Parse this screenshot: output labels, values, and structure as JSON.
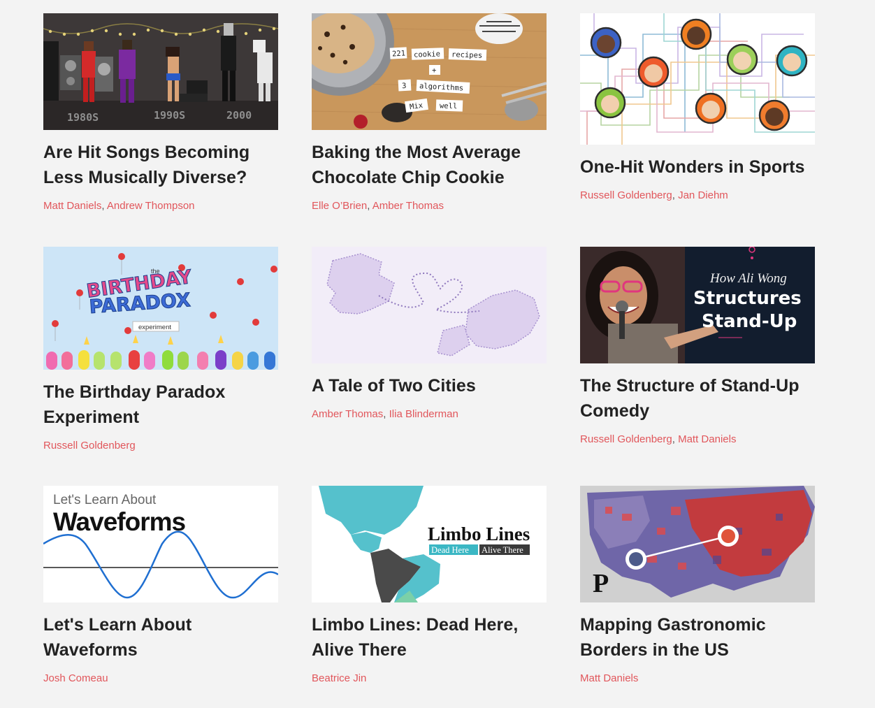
{
  "stories": [
    {
      "title": "Are Hit Songs Becoming Less Musically Diverse?",
      "authors": [
        "Matt Daniels",
        "Andrew Thompson"
      ],
      "thumb": {
        "years": [
          "1980S",
          "1990S",
          "2000"
        ]
      }
    },
    {
      "title": "Baking the Most Average Chocolate Chip Cookie",
      "authors": [
        "Elle O’Brien",
        "Amber Thomas"
      ],
      "thumb": {
        "tiles": [
          "221",
          "cookie",
          "recipes",
          "+",
          "3",
          "algorithms",
          "Mix",
          "well"
        ]
      }
    },
    {
      "title": "One-Hit Wonders in Sports",
      "authors": [
        "Russell Goldenberg",
        "Jan Diehm"
      ],
      "thumb": {}
    },
    {
      "title": "The Birthday Paradox Experiment",
      "authors": [
        "Russell Goldenberg"
      ],
      "thumb": {
        "the": "the",
        "line1": "BIRTHDAY",
        "line2": "PARADOX",
        "tag": "experiment"
      }
    },
    {
      "title": "A Tale of Two Cities",
      "authors": [
        "Amber Thomas",
        "Ilia Blinderman"
      ],
      "thumb": {}
    },
    {
      "title": "The Structure of Stand-Up Comedy",
      "authors": [
        "Russell Goldenberg",
        "Matt Daniels"
      ],
      "thumb": {
        "kicker": "How Ali Wong",
        "line1": "Structures",
        "line2": "Stand-Up"
      }
    },
    {
      "title": "Let's Learn About Waveforms",
      "authors": [
        "Josh Comeau"
      ],
      "thumb": {
        "kicker": "Let's Learn About",
        "headline": "Waveforms"
      }
    },
    {
      "title": "Limbo Lines: Dead Here, Alive There",
      "authors": [
        "Beatrice Jin"
      ],
      "thumb": {
        "headline": "Limbo Lines",
        "tag1": "Dead Here",
        "tag2": "Alive There"
      }
    },
    {
      "title": "Mapping Gastronomic Borders in the US",
      "authors": [
        "Matt Daniels"
      ],
      "thumb": {
        "logo": "P"
      }
    }
  ],
  "colors": {
    "author_link": "#e1565b",
    "title": "#222222",
    "background": "#f3f3f3"
  }
}
